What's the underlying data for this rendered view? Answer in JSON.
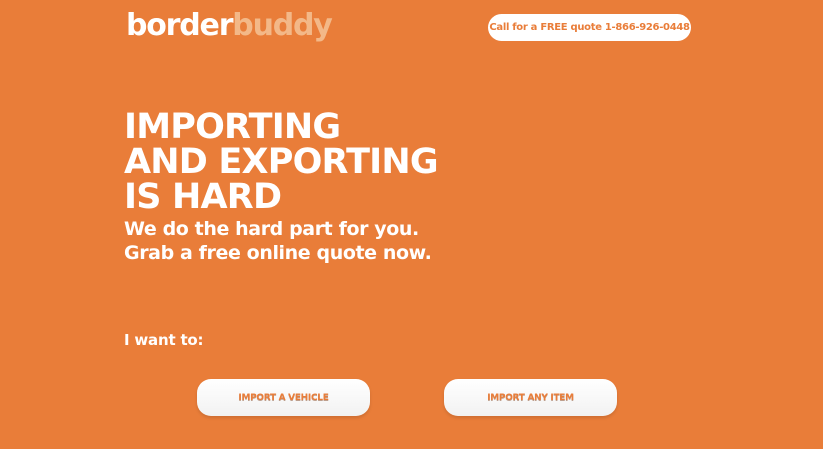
{
  "header": {
    "logo_part1": "border",
    "logo_part2": "buddy",
    "call_label": "Call for a FREE quote 1-866-926-0448"
  },
  "hero": {
    "headline_lines": [
      "IMPORTING",
      "AND EXPORTING",
      "IS HARD"
    ],
    "subhead_lines": [
      "We do the hard part for you.",
      "Grab a free online quote now."
    ]
  },
  "choices": {
    "label": "I want to:",
    "vehicle_label": "IMPORT A VEHICLE",
    "item_label": "IMPORT ANY ITEM"
  },
  "colors": {
    "background": "#E97D39",
    "logo_accent": "#F3B888",
    "text": "#FFFFFF"
  }
}
